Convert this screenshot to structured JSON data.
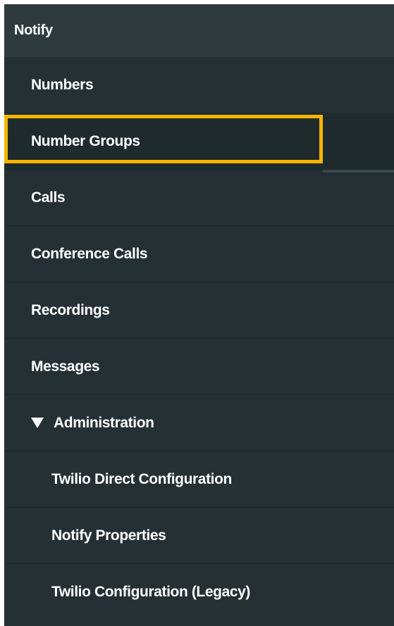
{
  "header": {
    "title": "Notify"
  },
  "menu": {
    "items": [
      {
        "label": "Numbers"
      },
      {
        "label": "Number Groups"
      },
      {
        "label": "Calls"
      },
      {
        "label": "Conference Calls"
      },
      {
        "label": "Recordings"
      },
      {
        "label": "Messages"
      },
      {
        "label": "Administration"
      }
    ],
    "admin_items": [
      {
        "label": "Twilio Direct Configuration"
      },
      {
        "label": "Notify Properties"
      },
      {
        "label": "Twilio Configuration (Legacy)"
      }
    ]
  },
  "colors": {
    "sidebar_bg": "#243034",
    "header_bg": "#2e3a3e",
    "highlight": "#f5b400",
    "text": "#ffffff"
  }
}
